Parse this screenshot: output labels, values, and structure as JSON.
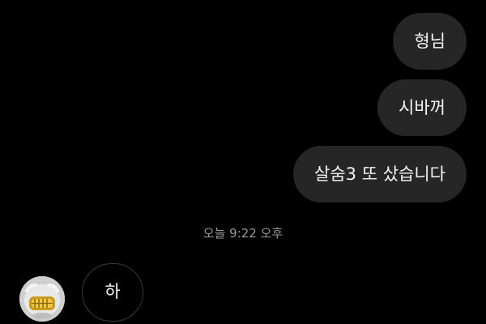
{
  "conversation": {
    "outgoing": [
      {
        "text": "형님"
      },
      {
        "text": "시바꺼"
      },
      {
        "text": "살숨3 또 샀습니다"
      }
    ],
    "timestamp": "오늘 9:22 오후",
    "incoming": [
      {
        "text": "하"
      }
    ]
  },
  "colors": {
    "background": "#000000",
    "outgoing_bubble": "#262626",
    "incoming_bubble_border": "#3a3a3a",
    "timestamp_text": "#9a9a9a"
  },
  "icons": {
    "avatar": "profile-avatar-icon"
  }
}
